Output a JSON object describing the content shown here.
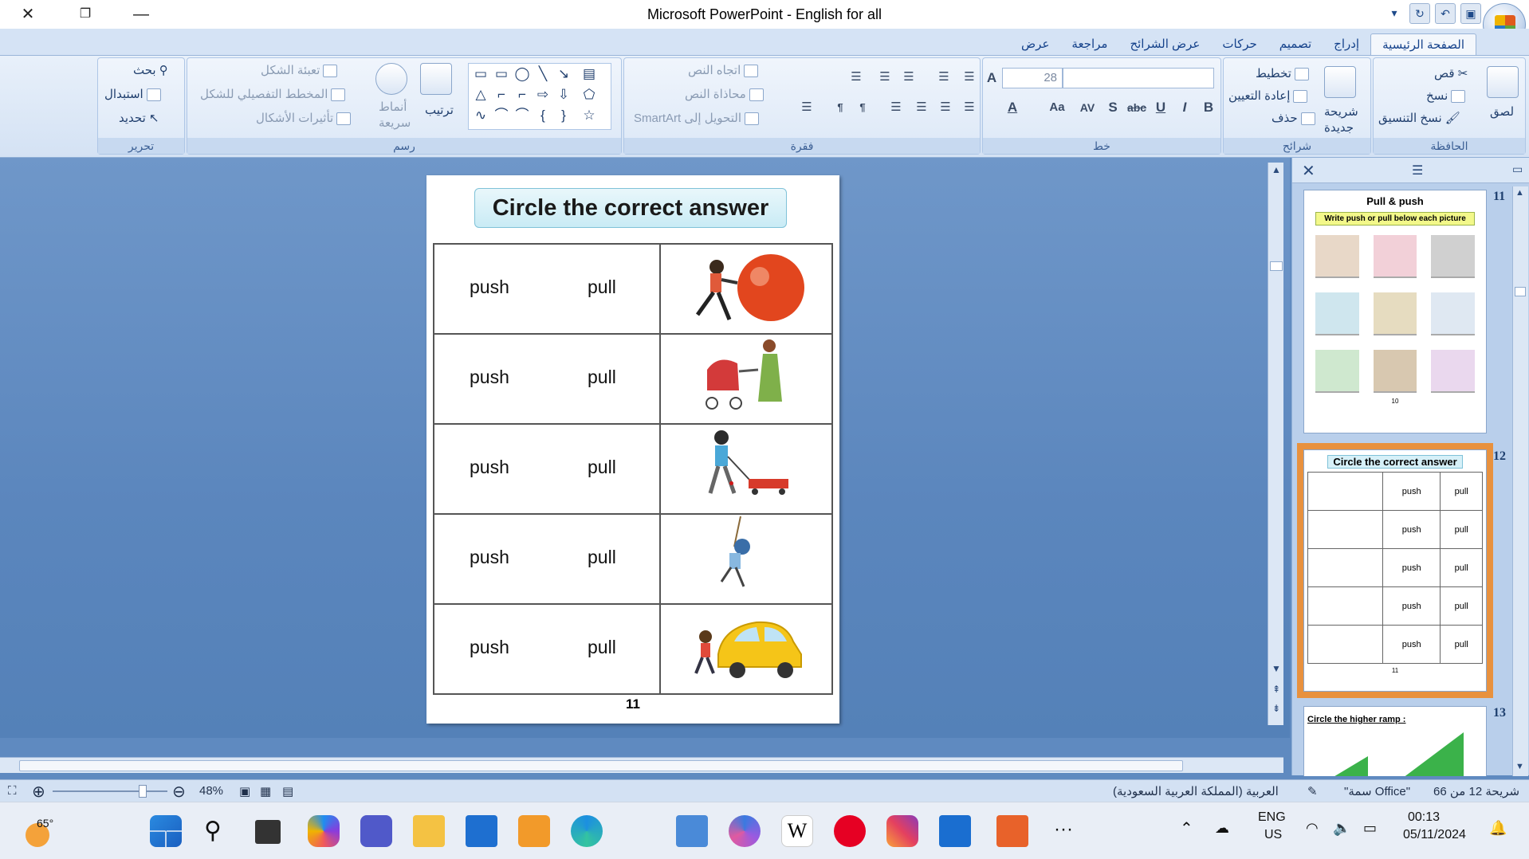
{
  "window": {
    "title": "Microsoft PowerPoint - English for all"
  },
  "tabs": [
    "الصفحة الرئيسية",
    "إدراج",
    "تصميم",
    "حركات",
    "عرض الشرائح",
    "مراجعة",
    "عرض"
  ],
  "ribbon": {
    "clipboard": {
      "label": "الحافظة",
      "paste": "لصق",
      "cut": "قص",
      "copy": "نسخ",
      "format_painter": "نسخ التنسيق"
    },
    "slides": {
      "label": "شرائح",
      "new_slide_line1": "شريحة",
      "new_slide_line2": "جديدة",
      "layout": "تخطيط",
      "reset": "إعادة التعيين",
      "delete": "حذف"
    },
    "font": {
      "label": "خط",
      "size": "28"
    },
    "paragraph": {
      "label": "فقرة",
      "text_direction": "اتجاه النص",
      "align_text": "محاذاة النص",
      "smartart": "التحويل إلى SmartArt"
    },
    "drawing": {
      "label": "رسم",
      "arrange": "ترتيب",
      "quick_styles_line1": "أنماط",
      "quick_styles_line2": "سريعة",
      "shape_fill": "تعبئة الشكل",
      "shape_outline": "المخطط التفصيلي للشكل",
      "shape_effects": "تأثيرات الأشكال"
    },
    "editing": {
      "label": "تحرير",
      "find": "بحث",
      "replace": "استبدال",
      "select": "تحديد"
    }
  },
  "slide": {
    "title": "Circle the correct answer",
    "rows": [
      {
        "picture": "boy-pushing-ball",
        "option1": "push",
        "option2": "pull"
      },
      {
        "picture": "woman-pushing-stroller",
        "option1": "push",
        "option2": "pull"
      },
      {
        "picture": "boy-pulling-wagon",
        "option1": "push",
        "option2": "pull"
      },
      {
        "picture": "child-pulling-rope",
        "option1": "push",
        "option2": "pull"
      },
      {
        "picture": "boy-pushing-car",
        "option1": "push",
        "option2": "pull"
      }
    ],
    "page_number": "11"
  },
  "thumbnails": [
    {
      "number": "11",
      "title": "Pull & push",
      "subtitle": "Write push or pull below each picture",
      "page": "10"
    },
    {
      "number": "12",
      "title": "Circle the correct answer",
      "page": "11"
    },
    {
      "number": "13",
      "title": "Circle the higher ramp :"
    }
  ],
  "status": {
    "slide_info": "شريحة 12 من 66",
    "theme": "\"سمة Office\"",
    "language": "العربية (المملكة العربية السعودية)",
    "zoom": "48%"
  },
  "taskbar": {
    "weather": "65°",
    "lang_line1": "ENG",
    "lang_line2": "US",
    "time": "00:13",
    "date": "05/11/2024"
  }
}
